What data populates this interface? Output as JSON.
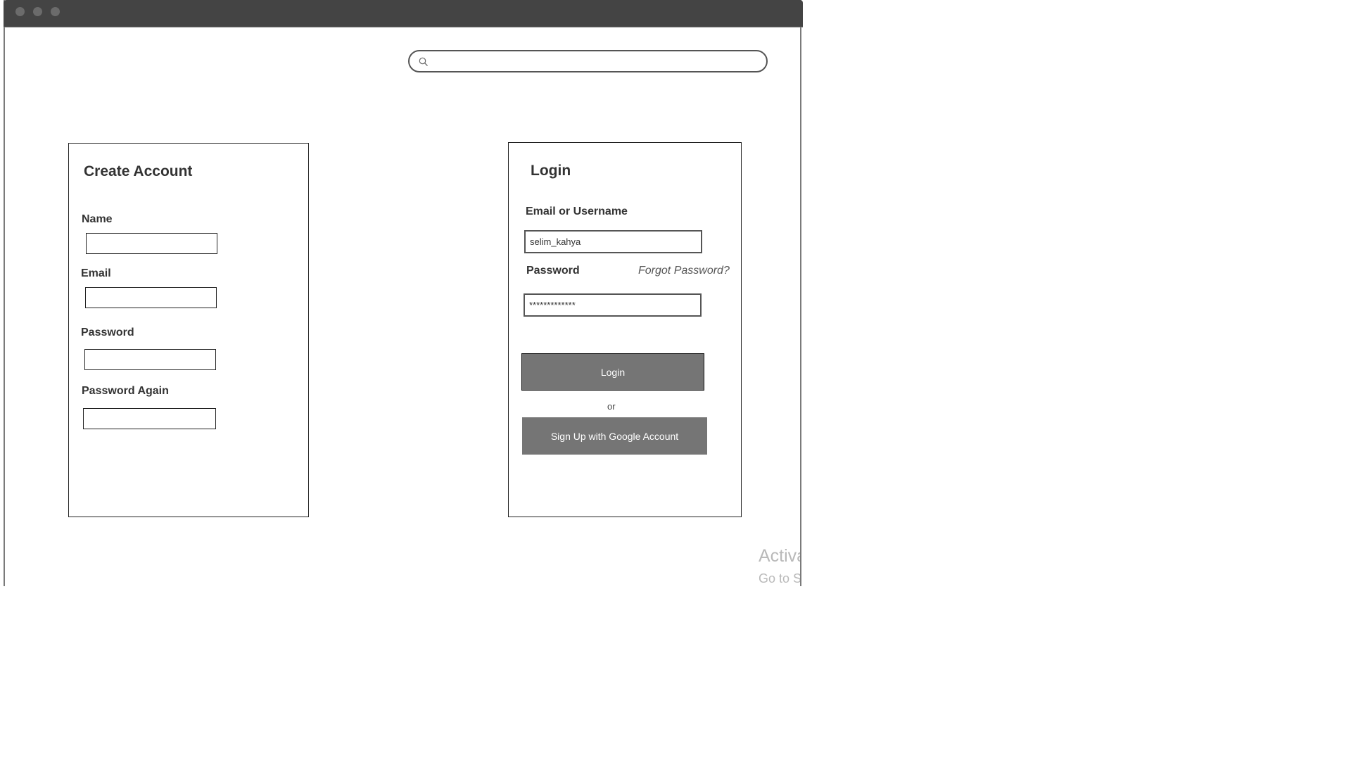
{
  "window": {
    "titlebar_buttons": [
      "close",
      "minimize",
      "maximize"
    ]
  },
  "search": {
    "icon": "search-icon",
    "value": "",
    "placeholder": ""
  },
  "create_account": {
    "title": "Create Account",
    "fields": [
      {
        "label": "Name",
        "value": ""
      },
      {
        "label": "Email",
        "value": ""
      },
      {
        "label": "Password",
        "value": ""
      },
      {
        "label": "Password Again",
        "value": ""
      }
    ]
  },
  "login": {
    "title": "Login",
    "username_label": "Email or Username",
    "username_value": "selim_kahya",
    "password_label": "Password",
    "password_value": "*************",
    "forgot_link": "Forgot Password?",
    "login_button": "Login",
    "separator": "or",
    "google_button": "Sign Up with Google Account"
  },
  "watermark": {
    "line1": "Activate Windows",
    "line2": "Go to Settings to activate Windows."
  },
  "colors": {
    "titlebar": "#444444",
    "button_fill": "#757575",
    "border": "#222222"
  }
}
